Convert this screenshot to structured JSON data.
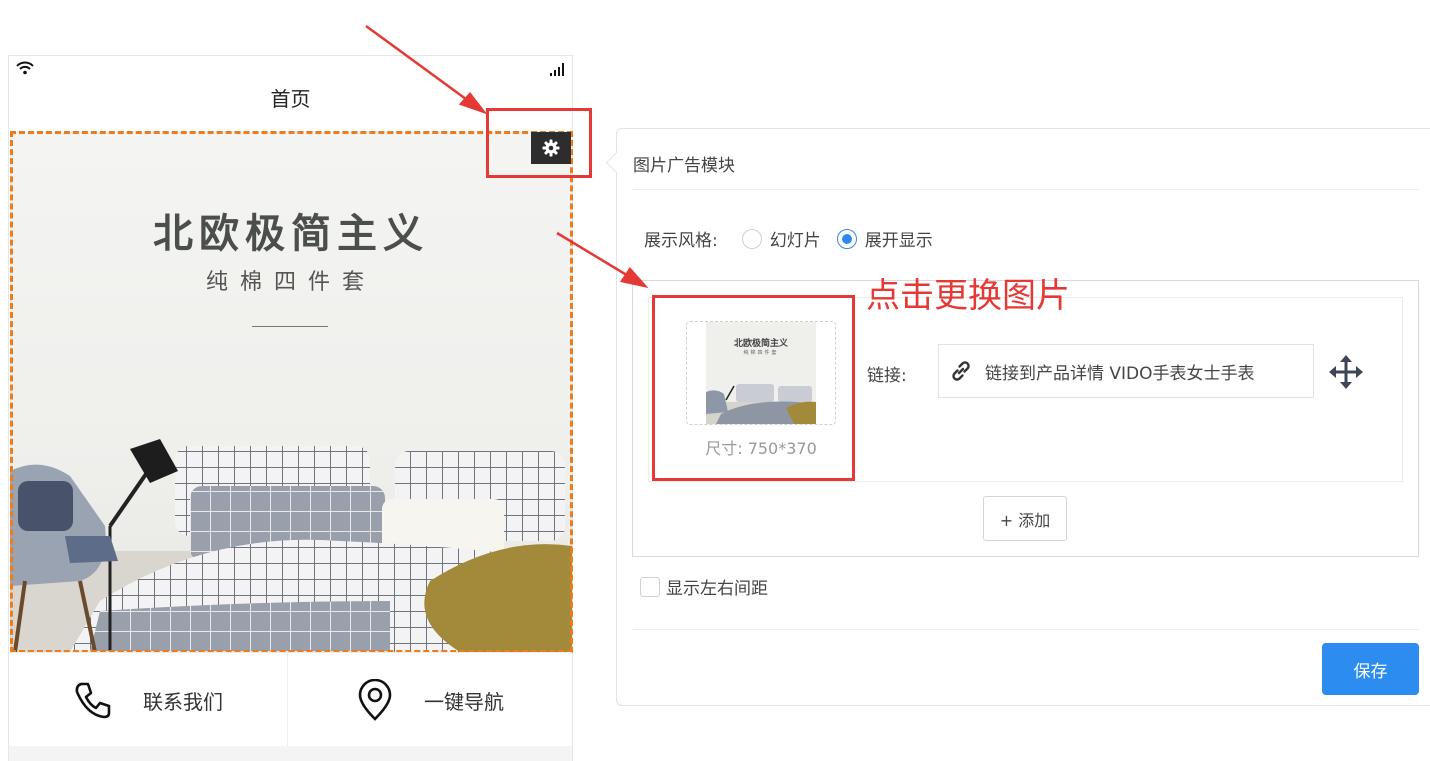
{
  "phone": {
    "title": "首页",
    "banner": {
      "title": "北欧极简主义",
      "subtitle": "纯棉四件套"
    },
    "nav": [
      {
        "label": "联系我们",
        "icon": "phone-icon"
      },
      {
        "label": "一键导航",
        "icon": "location-pin-icon"
      }
    ]
  },
  "annotation": {
    "hint": "点击更换图片",
    "color": "#e53935"
  },
  "panel": {
    "title": "图片广告模块",
    "style_label": "展示风格:",
    "style_options": [
      {
        "label": "幻灯片",
        "selected": false
      },
      {
        "label": "展开显示",
        "selected": true
      }
    ],
    "item": {
      "thumb_title": "北欧极简主义",
      "thumb_subtitle": "纯棉四件套",
      "size_text": "尺寸: 750*370",
      "link_label": "链接:",
      "link_value": "链接到产品详情 VIDO手表女士手表"
    },
    "add_button": "+ 添加",
    "spacing_label": "显示左右间距",
    "spacing_checked": false,
    "save_button": "保存"
  },
  "colors": {
    "accent": "#2d8cf0",
    "dashed_frame": "#f07b1a",
    "annotation_red": "#e53935"
  }
}
